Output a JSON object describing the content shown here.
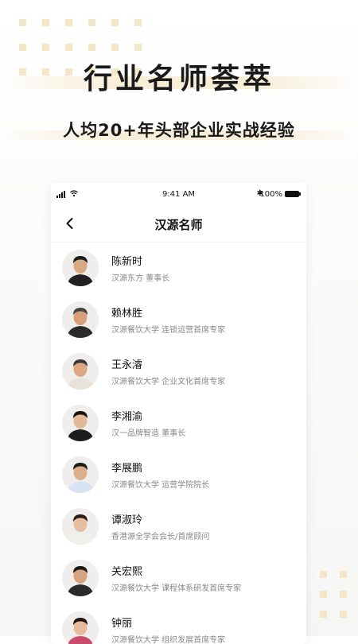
{
  "promo": {
    "headline": "行业名师荟萃",
    "subline": "人均20+年头部企业实战经验"
  },
  "status_bar": {
    "time": "9:41 AM",
    "battery": "100%",
    "bluetooth": "✱"
  },
  "nav": {
    "title": "汉源名师",
    "back_icon": "chevron-left-icon"
  },
  "teachers": [
    {
      "name": "陈新时",
      "role": "汉源东方  董事长",
      "hair": "#1c1c1c",
      "suit": "#222222",
      "skin": "#d9a982"
    },
    {
      "name": "赖林胜",
      "role": "汉源餐饮大学  连锁运营首席专家",
      "hair": "#444444",
      "suit": "#2a2a2a",
      "skin": "#d7a07a"
    },
    {
      "name": "王永濬",
      "role": "汉源餐饮大学  企业文化首席专家",
      "hair": "#3a3a3a",
      "suit": "#e9e2d6",
      "skin": "#dca882"
    },
    {
      "name": "李湘渝",
      "role": "汉一品牌智造  董事长",
      "hair": "#1a1410",
      "suit": "#1d1d1d",
      "skin": "#e3b898"
    },
    {
      "name": "李展鹏",
      "role": "汉源餐饮大学  运营学院院长",
      "hair": "#1d1d1d",
      "suit": "#d8e4f2",
      "skin": "#dcae8c"
    },
    {
      "name": "谭淑玲",
      "role": "香港源全学会会长/首席顾问",
      "hair": "#2a1d14",
      "suit": "#f1efe9",
      "skin": "#e6bfa2"
    },
    {
      "name": "关宏熙",
      "role": "汉源餐饮大学  课程体系研发首席专家",
      "hair": "#1a1a1a",
      "suit": "#2a2a2a",
      "skin": "#d6a580"
    },
    {
      "name": "钟丽",
      "role": "汉源餐饮大学  组织发展首席专家",
      "hair": "#1e140e",
      "suit": "#c94a6a",
      "skin": "#e5bb9c"
    }
  ],
  "colors": {
    "accent_band": "#f8ecd4",
    "dots": "#f6e6c8",
    "text_primary": "#111111",
    "text_secondary": "#888888"
  }
}
